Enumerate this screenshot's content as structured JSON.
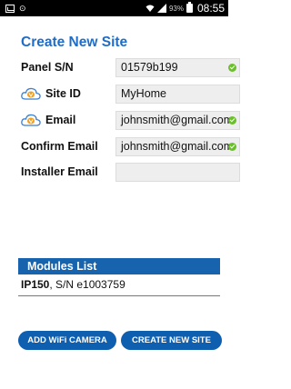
{
  "status_bar": {
    "battery_percent": "93%",
    "time": "08:55",
    "left_icons": [
      "image-icon",
      "voicemail-icon"
    ],
    "right_icons": [
      "wifi-icon",
      "signal-icon",
      "battery-icon"
    ]
  },
  "page": {
    "title": "Create New Site"
  },
  "form": {
    "panel_sn": {
      "label": "Panel S/N",
      "value": "01579b199",
      "valid": true
    },
    "site_id": {
      "label": "Site ID",
      "value": "MyHome",
      "icon": "cloud-icon"
    },
    "email": {
      "label": "Email",
      "value": "johnsmith@gmail.com",
      "icon": "cloud-icon",
      "valid": true
    },
    "confirm_email": {
      "label": "Confirm Email",
      "value": "johnsmith@gmail.com",
      "valid": true
    },
    "installer_email": {
      "label": "Installer Email",
      "value": ""
    }
  },
  "modules": {
    "header": "Modules List",
    "items": [
      {
        "name": "IP150",
        "serial": ", S/N e1003759"
      }
    ]
  },
  "buttons": {
    "add_camera": "ADD WiFi CAMERA",
    "create_site": "CREATE NEW SITE"
  },
  "colors": {
    "title_blue": "#1e6dc8",
    "header_blue": "#1763ad",
    "button_blue": "#0e5fb0",
    "check_green": "#6bbf2a",
    "cloud_orange": "#f0a020"
  }
}
